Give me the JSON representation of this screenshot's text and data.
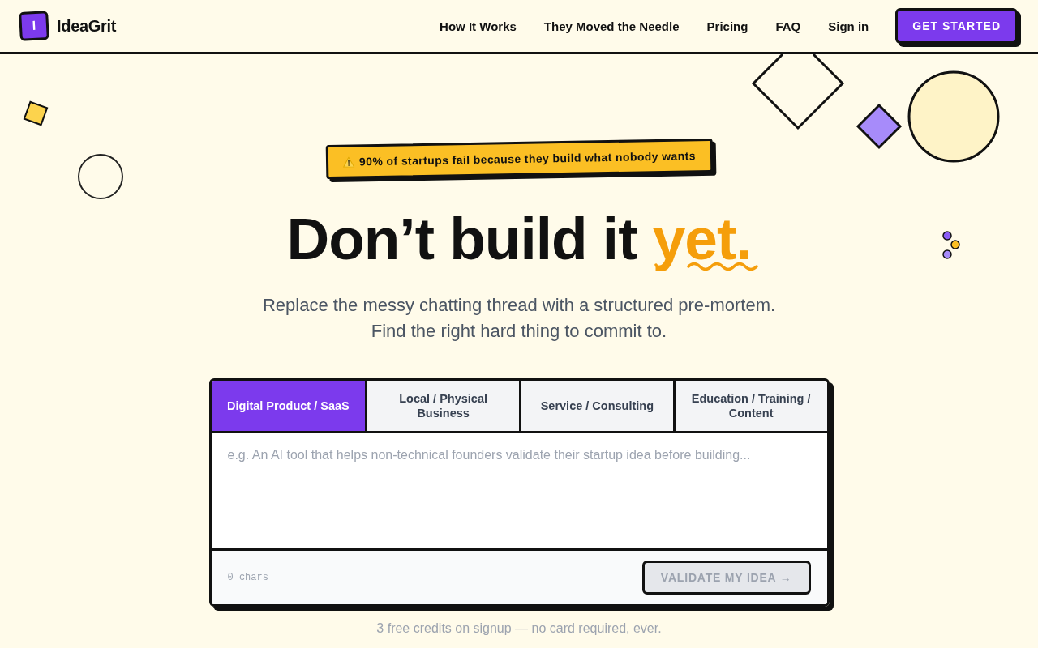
{
  "header": {
    "logo": {
      "letter": "I",
      "name": "IdeaGrit"
    },
    "nav": [
      {
        "label": "How It Works"
      },
      {
        "label": "They Moved the Needle"
      },
      {
        "label": "Pricing"
      },
      {
        "label": "FAQ"
      },
      {
        "label": "Sign in"
      }
    ],
    "cta": "GET STARTED"
  },
  "hero": {
    "badge": "90% of startups fail because they build what nobody wants",
    "title": "Don’t build it",
    "highlight": "yet.",
    "subtitle": [
      "Replace the messy chatting thread with a structured pre-mortem.",
      "Find the right hard thing to commit to."
    ]
  },
  "idea_form": {
    "tabs": [
      {
        "label": "Digital Product / SaaS",
        "selected": true
      },
      {
        "label": "Local / Physical Business",
        "selected": false
      },
      {
        "label": "Service / Consulting",
        "selected": false
      },
      {
        "label": "Education / Training / Content",
        "selected": false
      }
    ],
    "placeholder": "e.g. An AI tool that helps non-technical founders validate their startup idea before building...",
    "char_count": "0 chars",
    "submit": {
      "label": "VALIDATE MY IDEA →",
      "disabled": true
    }
  },
  "footnote": "3 free credits on signup — no card required, ever."
}
